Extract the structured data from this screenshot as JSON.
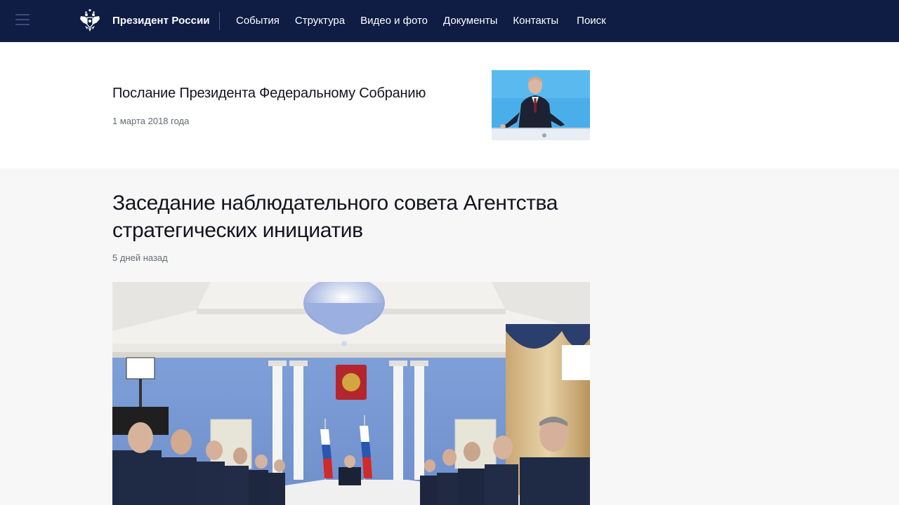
{
  "header": {
    "site_name": "Президент России",
    "nav": [
      "События",
      "Структура",
      "Видео и фото",
      "Документы",
      "Контакты"
    ],
    "search_label": "Поиск"
  },
  "featured": {
    "title": "Послание Президента Федеральному Собранию",
    "date": "1 марта 2018 года"
  },
  "news": {
    "title": "Заседание наблюдательного совета Агентства стратегических инициатив",
    "date": "5 дней назад"
  },
  "colors": {
    "header_bg": "#0f1c44",
    "page_bg": "#f7f7f7",
    "card_bg": "#ffffff"
  },
  "icons": {
    "menu": "hamburger-icon",
    "emblem": "double-headed-eagle-emblem"
  }
}
